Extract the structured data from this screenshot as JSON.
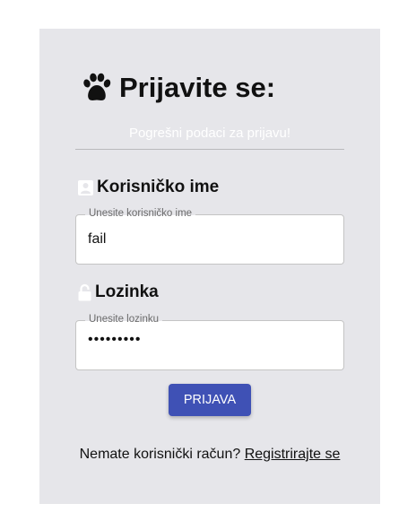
{
  "login": {
    "title": "Prijavite se:",
    "error_message": "Pogrešni podaci za prijavu!",
    "username": {
      "heading": "Korisničko ime",
      "label": "Unesite korisničko ime",
      "value": "fail",
      "icon": "user-icon"
    },
    "password": {
      "heading": "Lozinka",
      "label": "Unesite lozinku",
      "value": "•••••••••",
      "icon": "lock-icon"
    },
    "submit_label": "PRIJAVA",
    "register_prompt": "Nemate korisnički račun?",
    "register_link": "Registrirajte se"
  },
  "colors": {
    "card_background": "#e6e6ea",
    "primary_button": "#3f51b5",
    "error_text": "#ffffff"
  }
}
